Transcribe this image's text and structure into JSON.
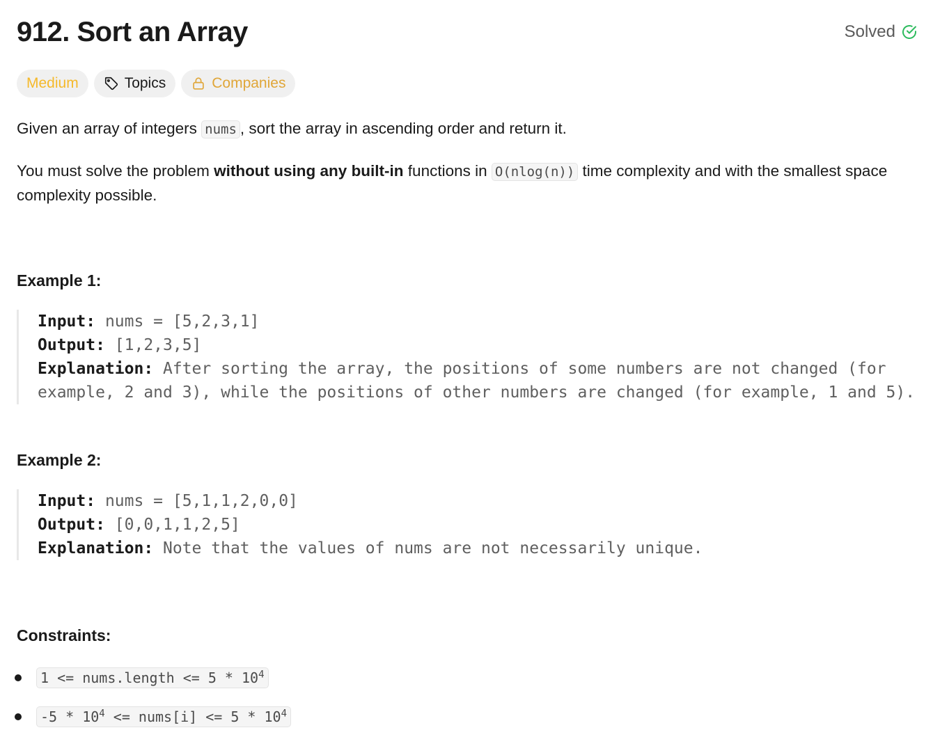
{
  "problem": {
    "title": "912. Sort an Array",
    "status": "Solved",
    "status_color": "#2cbb5d"
  },
  "tags": {
    "difficulty": "Medium",
    "topics": "Topics",
    "companies": "Companies",
    "colors": {
      "medium": "#f5b92a",
      "companies": "#e0a638"
    }
  },
  "description": {
    "p1_before": "Given an array of integers ",
    "p1_code": "nums",
    "p1_after": ", sort the array in ascending order and return it.",
    "p2_before": "You must solve the problem ",
    "p2_bold": "without using any built-in",
    "p2_mid": " functions in ",
    "p2_code": "O(nlog(n))",
    "p2_after": " time complexity and with the smallest space complexity possible."
  },
  "examples": [
    {
      "heading": "Example 1:",
      "input_label": "Input:",
      "input": " nums = [5,2,3,1]",
      "output_label": "Output:",
      "output": " [1,2,3,5]",
      "explanation_label": "Explanation:",
      "explanation": " After sorting the array, the positions of some numbers are not changed (for example, 2 and 3), while the positions of other numbers are changed (for example, 1 and 5)."
    },
    {
      "heading": "Example 2:",
      "input_label": "Input:",
      "input": " nums = [5,1,1,2,0,0]",
      "output_label": "Output:",
      "output": " [0,0,1,1,2,5]",
      "explanation_label": "Explanation:",
      "explanation": " Note that the values of nums are not necessarily unique."
    }
  ],
  "constraints": {
    "heading": "Constraints:",
    "c1_text": "1 <= nums.length <= 5 * 10",
    "c1_exp": "4",
    "c2_a": "-5 * 10",
    "c2_a_exp": "4",
    "c2_b": " <= nums[i] <= 5 * 10",
    "c2_b_exp": "4"
  },
  "icons": {
    "solved": "check-circle-icon",
    "topics": "tag-icon",
    "companies": "lock-icon"
  }
}
